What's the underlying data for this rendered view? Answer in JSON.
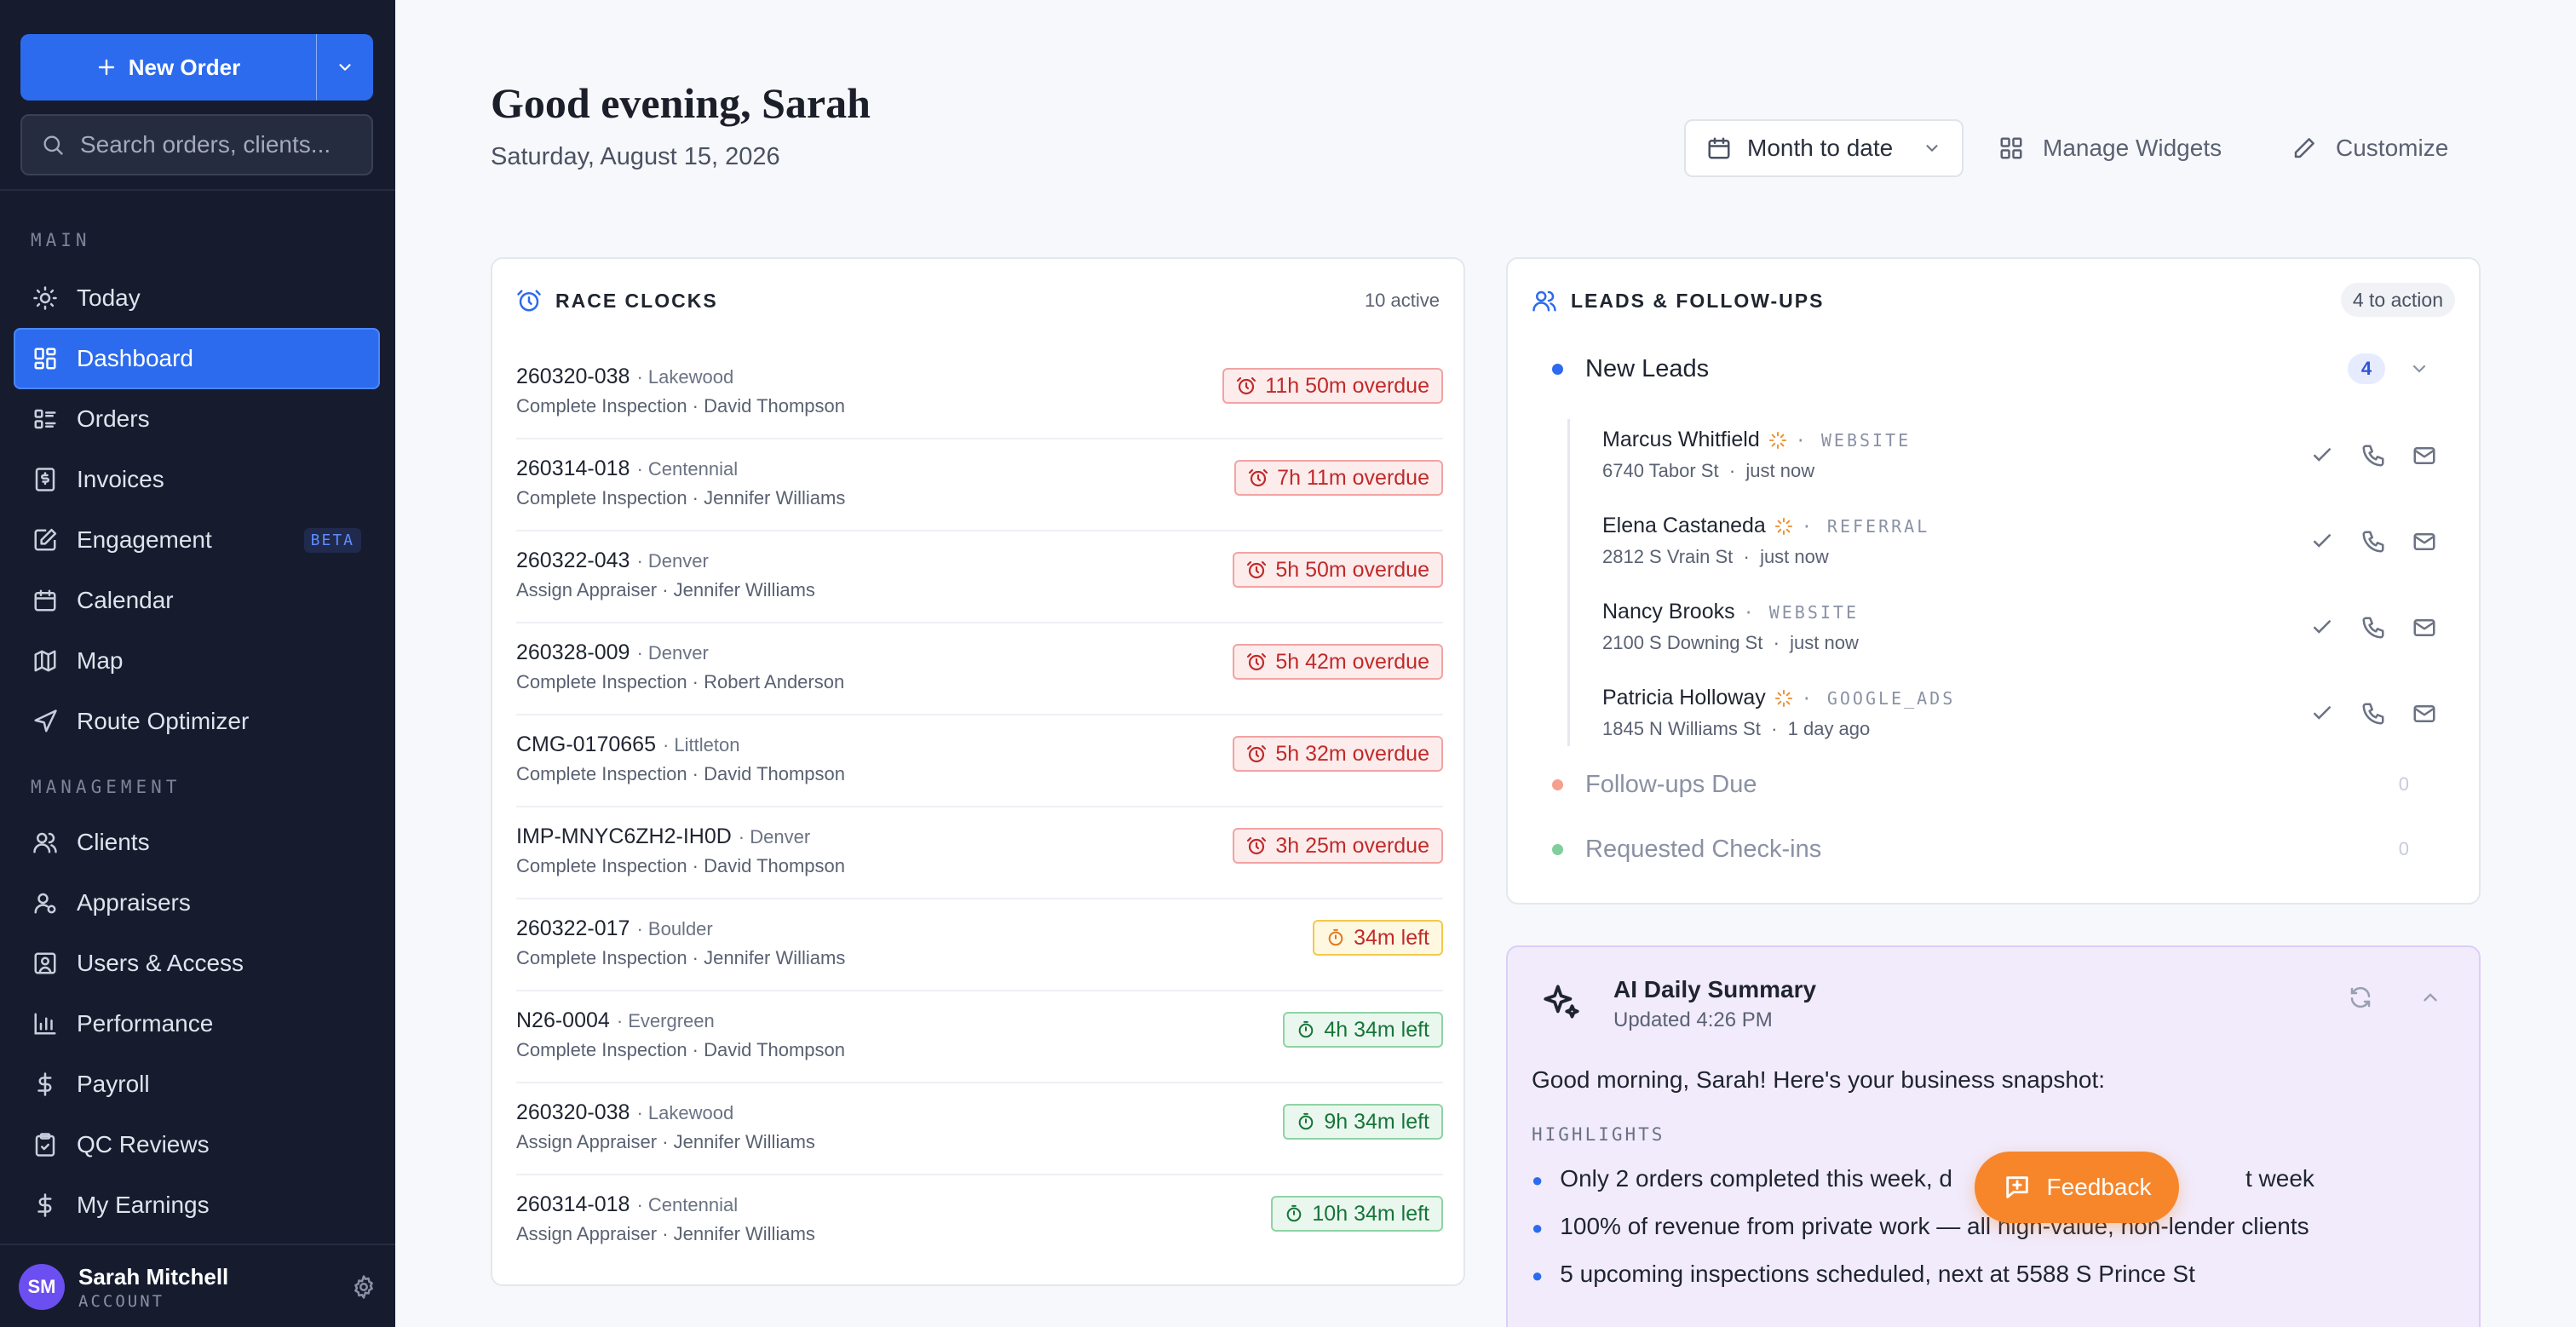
{
  "sidebar": {
    "new_order_label": "New Order",
    "search_placeholder": "Search orders, clients...",
    "main_section": "MAIN",
    "management_section": "MANAGEMENT",
    "items": [
      {
        "label": "Today",
        "icon": "sun-icon"
      },
      {
        "label": "Dashboard",
        "icon": "grid-icon",
        "active": true
      },
      {
        "label": "Orders",
        "icon": "list-icon"
      },
      {
        "label": "Invoices",
        "icon": "invoice-icon"
      },
      {
        "label": "Engagement",
        "icon": "edit-icon",
        "badge": "BETA"
      },
      {
        "label": "Calendar",
        "icon": "calendar-icon"
      },
      {
        "label": "Map",
        "icon": "map-icon"
      },
      {
        "label": "Route Optimizer",
        "icon": "navigation-icon"
      }
    ],
    "management_items": [
      {
        "label": "Clients",
        "icon": "users-icon"
      },
      {
        "label": "Appraisers",
        "icon": "user-cog-icon"
      },
      {
        "label": "Users & Access",
        "icon": "user-square-icon"
      },
      {
        "label": "Performance",
        "icon": "bar-chart-icon"
      },
      {
        "label": "Payroll",
        "icon": "dollar-icon"
      },
      {
        "label": "QC Reviews",
        "icon": "clipboard-icon"
      },
      {
        "label": "My Earnings",
        "icon": "dollar-icon"
      }
    ],
    "user": {
      "initials": "SM",
      "name": "Sarah Mitchell",
      "role": "ACCOUNT"
    }
  },
  "header": {
    "greeting": "Good evening, Sarah",
    "date": "Saturday, August 15, 2026",
    "period": "Month to date",
    "manage_widgets": "Manage Widgets",
    "customize": "Customize"
  },
  "race_clocks": {
    "title": "RACE CLOCKS",
    "active": "10 active",
    "rows": [
      {
        "id": "260320-038",
        "loc": "· Lakewood",
        "sub": "Complete Inspection · David Thompson",
        "status": "11h 50m overdue",
        "level": "red"
      },
      {
        "id": "260314-018",
        "loc": "· Centennial",
        "sub": "Complete Inspection · Jennifer Williams",
        "status": "7h 11m overdue",
        "level": "red"
      },
      {
        "id": "260322-043",
        "loc": "· Denver",
        "sub": "Assign Appraiser · Jennifer Williams",
        "status": "5h 50m overdue",
        "level": "red"
      },
      {
        "id": "260328-009",
        "loc": "· Denver",
        "sub": "Complete Inspection · Robert Anderson",
        "status": "5h 42m overdue",
        "level": "red"
      },
      {
        "id": "CMG-0170665",
        "loc": "· Littleton",
        "sub": "Complete Inspection · David Thompson",
        "status": "5h 32m overdue",
        "level": "red"
      },
      {
        "id": "IMP-MNYC6ZH2-IH0D",
        "loc": "· Denver",
        "sub": "Complete Inspection · David Thompson",
        "status": "3h 25m overdue",
        "level": "red"
      },
      {
        "id": "260322-017",
        "loc": "· Boulder",
        "sub": "Complete Inspection · Jennifer Williams",
        "status": "34m left",
        "level": "yellow"
      },
      {
        "id": "N26-0004",
        "loc": "· Evergreen",
        "sub": "Complete Inspection · David Thompson",
        "status": "4h 34m left",
        "level": "green"
      },
      {
        "id": "260320-038",
        "loc": "· Lakewood",
        "sub": "Assign Appraiser · Jennifer Williams",
        "status": "9h 34m left",
        "level": "green"
      },
      {
        "id": "260314-018",
        "loc": "· Centennial",
        "sub": "Assign Appraiser · Jennifer Williams",
        "status": "10h 34m left",
        "level": "green"
      }
    ]
  },
  "leads": {
    "title": "LEADS & FOLLOW-UPS",
    "badge": "4 to action",
    "new_leads": {
      "label": "New Leads",
      "count": "4"
    },
    "items": [
      {
        "name": "Marcus Whitfield",
        "hot": true,
        "source": "WEBSITE",
        "address": "6740 Tabor St",
        "time": "just now"
      },
      {
        "name": "Elena Castaneda",
        "hot": true,
        "source": "REFERRAL",
        "address": "2812 S Vrain St",
        "time": "just now"
      },
      {
        "name": "Nancy Brooks",
        "hot": false,
        "source": "WEBSITE",
        "address": "2100 S Downing St",
        "time": "just now"
      },
      {
        "name": "Patricia Holloway",
        "hot": true,
        "source": "GOOGLE_ADS",
        "address": "1845 N Williams St",
        "time": "1 day ago"
      }
    ],
    "follow_ups": {
      "label": "Follow-ups Due",
      "count": "0"
    },
    "check_ins": {
      "label": "Requested Check-ins",
      "count": "0"
    }
  },
  "ai_summary": {
    "title": "AI Daily Summary",
    "updated": "Updated 4:26 PM",
    "intro": "Good morning, Sarah! Here's your business snapshot:",
    "highlights_label": "HIGHLIGHTS",
    "bullets": [
      "Only 2 orders completed this week, d",
      "100% of revenue from private work — all high-value, non-lender clients",
      "5 upcoming inspections scheduled, next at 5588 S Prince St"
    ],
    "bullet_tail": "t week"
  },
  "feedback_label": "Feedback",
  "colors": {
    "accent": "#2c6bed",
    "sidebar": "#161b2e",
    "overdue": "#c12a2a",
    "ok": "#16753a",
    "feedback": "#f7862b"
  }
}
